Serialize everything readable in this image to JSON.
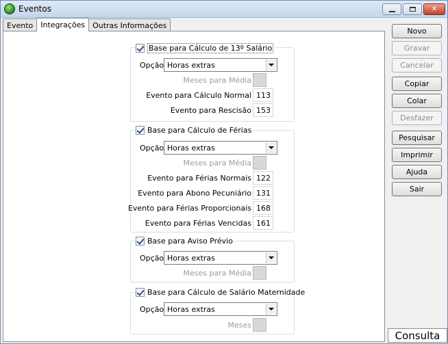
{
  "window": {
    "title": "Eventos"
  },
  "tabs": [
    "Evento",
    "Integrações",
    "Outras Informações"
  ],
  "groups": {
    "decimo": {
      "title": "Base para Cálculo de 13º Salário",
      "option_label": "Opção",
      "option_value": "Horas extras",
      "meses_label": "Meses para Média",
      "fields": [
        {
          "label": "Evento para Cálculo Normal",
          "value": "113"
        },
        {
          "label": "Evento para Rescisão",
          "value": "153"
        }
      ]
    },
    "ferias": {
      "title": "Base para Cálculo de Férias",
      "option_label": "Opção",
      "option_value": "Horas extras",
      "meses_label": "Meses para Média",
      "fields": [
        {
          "label": "Evento para Férias Normais",
          "value": "122"
        },
        {
          "label": "Evento para Abono Pecuniário",
          "value": "131"
        },
        {
          "label": "Evento para Férias Proporcionais",
          "value": "168"
        },
        {
          "label": "Evento para Férias Vencidas",
          "value": "161"
        }
      ]
    },
    "aviso": {
      "title": "Base para Aviso Prévio",
      "option_label": "Opção",
      "option_value": "Horas extras",
      "meses_label": "Meses para Média"
    },
    "maternidade": {
      "title": "Base para Cálculo de Salário Maternidade",
      "option_label": "Opção",
      "option_value": "Horas extras",
      "meses_label": "Meses"
    }
  },
  "buttons": {
    "novo": {
      "label": "Novo",
      "disabled": false
    },
    "gravar": {
      "label": "Gravar",
      "disabled": true
    },
    "cancelar": {
      "label": "Cancelar",
      "disabled": true
    },
    "copiar": {
      "label": "Copiar",
      "disabled": false
    },
    "colar": {
      "label": "Colar",
      "disabled": false
    },
    "desfazer": {
      "label": "Desfazer",
      "disabled": true
    },
    "pesquisar": {
      "label": "Pesquisar",
      "disabled": false
    },
    "imprimir": {
      "label": "Imprimir",
      "disabled": false
    },
    "ajuda": {
      "label": "Ajuda",
      "disabled": false
    },
    "sair": {
      "label": "Sair",
      "disabled": false
    }
  },
  "status": {
    "mode": "Consulta"
  },
  "icons": [
    "app-icon",
    "minimize-icon",
    "maximize-icon",
    "close-icon",
    "checkbox-checked-icon",
    "chevron-down-icon"
  ]
}
